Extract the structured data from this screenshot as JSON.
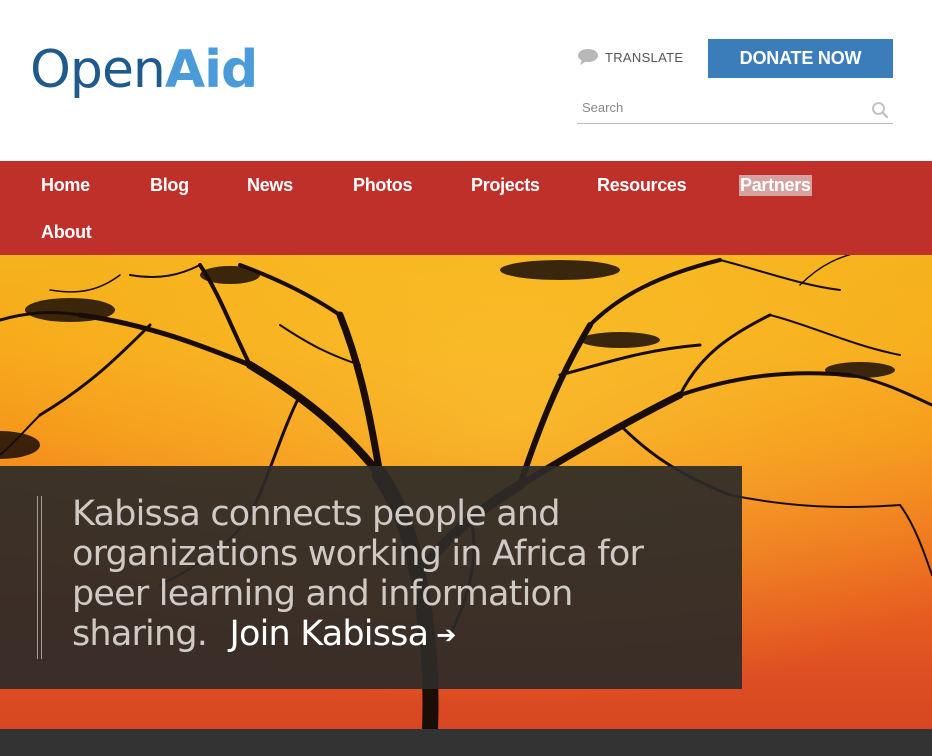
{
  "logo": {
    "part1": "Open",
    "part2": "Aid"
  },
  "header": {
    "translate_label": "TRANSLATE",
    "donate_label": "DONATE NOW",
    "search_placeholder": "Search"
  },
  "nav": {
    "items": [
      {
        "label": "Home"
      },
      {
        "label": "Blog"
      },
      {
        "label": "News"
      },
      {
        "label": "Photos"
      },
      {
        "label": "Projects"
      },
      {
        "label": "Resources"
      },
      {
        "label": "Partners"
      },
      {
        "label": "About"
      }
    ]
  },
  "hero": {
    "caption": "Kabissa connects people and organizations working in Africa for peer learning and information sharing.",
    "cta_label": "Join Kabissa",
    "cta_arrow": "➔"
  },
  "icons": {
    "translate": "speech-bubble-icon",
    "search": "search-icon",
    "cta": "arrow-right-icon"
  },
  "colors": {
    "brand_dark": "#1f5a8c",
    "brand_light": "#4a9bd8",
    "donate_bg": "#3b7dba",
    "nav_bg": "#c0302a",
    "caption_bg": "#2d2a28"
  }
}
